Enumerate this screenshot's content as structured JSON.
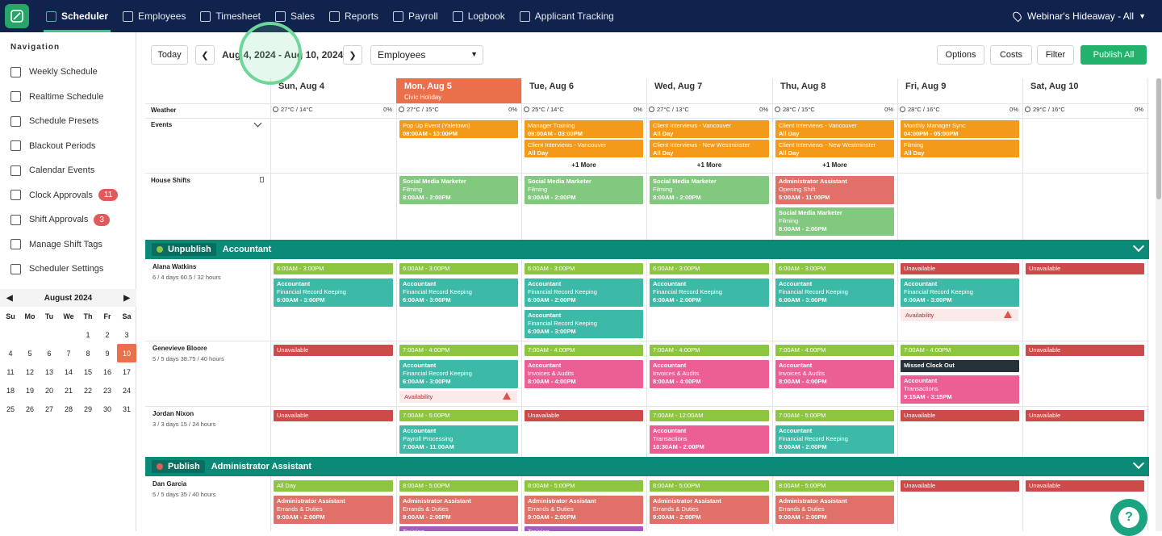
{
  "topbar": {
    "nav": [
      "Scheduler",
      "Employees",
      "Timesheet",
      "Sales",
      "Reports",
      "Payroll",
      "Logbook",
      "Applicant Tracking"
    ],
    "location": "Webinar's Hideaway - All"
  },
  "sidebar": {
    "title": "Navigation",
    "items": [
      {
        "label": "Weekly Schedule",
        "icon": "calendar-icon"
      },
      {
        "label": "Realtime Schedule",
        "icon": "calendar-icon"
      },
      {
        "label": "Schedule Presets",
        "icon": "calendar-edit-icon"
      },
      {
        "label": "Blackout Periods",
        "icon": "calendar-x-icon"
      },
      {
        "label": "Calendar Events",
        "icon": "calendar-star-icon"
      },
      {
        "label": "Clock Approvals",
        "icon": "clock-icon",
        "badge": "11"
      },
      {
        "label": "Shift Approvals",
        "icon": "users-icon",
        "badge": "3"
      },
      {
        "label": "Manage Shift Tags",
        "icon": "tag-icon"
      },
      {
        "label": "Scheduler Settings",
        "icon": "gear-icon"
      }
    ],
    "calendar": {
      "month": "August 2024",
      "dow": [
        "Su",
        "Mo",
        "Tu",
        "We",
        "Th",
        "Fr",
        "Sa"
      ],
      "weeks": [
        [
          "",
          "",
          "",
          "",
          "1",
          "2",
          "3"
        ],
        [
          "4",
          "5",
          "6",
          "7",
          "8",
          "9",
          "10"
        ],
        [
          "11",
          "12",
          "13",
          "14",
          "15",
          "16",
          "17"
        ],
        [
          "18",
          "19",
          "20",
          "21",
          "22",
          "23",
          "24"
        ],
        [
          "25",
          "26",
          "27",
          "28",
          "29",
          "30",
          "31"
        ]
      ],
      "selected": "10"
    }
  },
  "toolbar": {
    "today": "Today",
    "range": "Aug 4, 2024 - Aug 10, 2024",
    "view": "Employees",
    "options": "Options",
    "costs": "Costs",
    "filter": "Filter",
    "publish_all": "Publish All"
  },
  "days": [
    {
      "label": "Sun, Aug 4",
      "sub": "",
      "weather": "27°C / 14°C",
      "rain": "0%"
    },
    {
      "label": "Mon, Aug 5",
      "sub": "Civic Holiday",
      "weather": "27°C / 15°C",
      "rain": "0%",
      "today": true
    },
    {
      "label": "Tue, Aug 6",
      "sub": "",
      "weather": "25°C / 14°C",
      "rain": "0%"
    },
    {
      "label": "Wed, Aug 7",
      "sub": "",
      "weather": "27°C / 13°C",
      "rain": "0%"
    },
    {
      "label": "Thu, Aug 8",
      "sub": "",
      "weather": "28°C / 15°C",
      "rain": "0%"
    },
    {
      "label": "Fri, Aug 9",
      "sub": "",
      "weather": "28°C / 16°C",
      "rain": "0%"
    },
    {
      "label": "Sat, Aug 10",
      "sub": "",
      "weather": "29°C / 16°C",
      "rain": "0%"
    }
  ],
  "rows": {
    "weather": "Weather",
    "events": "Events",
    "house": "House Shifts",
    "more": "+1 More"
  },
  "events": [
    {
      "day": 1,
      "slot": 0,
      "title": "Pop Up Event (Yaletown)",
      "time": "08:00AM - 10:00PM"
    },
    {
      "day": 2,
      "slot": 0,
      "title": "Manager Training",
      "time": "09:00AM - 03:00PM"
    },
    {
      "day": 2,
      "slot": 1,
      "title": "Client Interviews - Vancouver",
      "time": "All Day"
    },
    {
      "day": 3,
      "slot": 0,
      "title": "Client Interviews - Vancouver",
      "time": "All Day"
    },
    {
      "day": 3,
      "slot": 1,
      "title": "Client Interviews - New Westminster",
      "time": "All Day"
    },
    {
      "day": 4,
      "slot": 0,
      "title": "Client Interviews - Vancouver",
      "time": "All Day"
    },
    {
      "day": 4,
      "slot": 1,
      "title": "Client Interviews - New Westminster",
      "time": "All Day"
    },
    {
      "day": 5,
      "slot": 0,
      "title": "Monthly Manager Sync",
      "time": "04:00PM - 05:00PM"
    },
    {
      "day": 5,
      "slot": 1,
      "title": "Filming",
      "time": "All Day"
    }
  ],
  "house_shifts": [
    {
      "day": 1,
      "slot": 0,
      "role": "Social Media Marketer",
      "task": "Filming",
      "time": "8:00AM - 2:00PM",
      "color": "green"
    },
    {
      "day": 2,
      "slot": 0,
      "role": "Social Media Marketer",
      "task": "Filming",
      "time": "8:00AM - 2:00PM",
      "color": "green"
    },
    {
      "day": 3,
      "slot": 0,
      "role": "Social Media Marketer",
      "task": "Filming",
      "time": "8:00AM - 2:00PM",
      "color": "green"
    },
    {
      "day": 4,
      "slot": 0,
      "role": "Administrator Assistant",
      "task": "Opening Shift",
      "time": "5:00AM - 11:00PM",
      "color": "red"
    },
    {
      "day": 4,
      "slot": 1,
      "role": "Social Media Marketer",
      "task": "Filming",
      "time": "8:00AM - 2:00PM",
      "color": "green"
    }
  ],
  "groups": [
    {
      "action": "Unpublish",
      "name": "Accountant",
      "dot": "#8dc53f"
    },
    {
      "action": "Publish",
      "name": "Administrator Assistant",
      "dot": "#e05a5a"
    }
  ],
  "employees": [
    {
      "name": "Alana Watkins",
      "meta": "6 / 4 days   60.5 / 32 hours"
    },
    {
      "name": "Genevieve Bloore",
      "meta": "5 / 5 days   38.75 / 40 hours"
    },
    {
      "name": "Jordan Nixon",
      "meta": "3 / 3 days   15 / 24 hours"
    },
    {
      "name": "Dan Garcia",
      "meta": "5 / 5 days   35 / 40 hours"
    }
  ],
  "labels": {
    "unavailable": "Unavailable",
    "availability": "Availability",
    "missed": "Missed Clock Out",
    "allday": "All Day",
    "training": "Training"
  },
  "shifts": [
    {
      "emp": 0,
      "day": 0,
      "avail": "6:00AM - 3:00PM",
      "blocks": [
        {
          "role": "Accountant",
          "task": "Financial Record Keeping",
          "time": "6:00AM - 3:00PM",
          "color": "teal"
        }
      ]
    },
    {
      "emp": 0,
      "day": 1,
      "avail": "6:00AM - 3:00PM",
      "blocks": [
        {
          "role": "Accountant",
          "task": "Financial Record Keeping",
          "time": "6:00AM - 3:00PM",
          "color": "teal"
        }
      ]
    },
    {
      "emp": 0,
      "day": 2,
      "avail": "6:00AM - 3:00PM",
      "blocks": [
        {
          "role": "Accountant",
          "task": "Financial Record Keeping",
          "time": "6:00AM - 2:00PM",
          "color": "teal"
        },
        {
          "role": "Accountant",
          "task": "Financial Record Keeping",
          "time": "6:00AM - 3:00PM",
          "color": "teal"
        }
      ]
    },
    {
      "emp": 0,
      "day": 3,
      "avail": "6:00AM - 3:00PM",
      "blocks": [
        {
          "role": "Accountant",
          "task": "Financial Record Keeping",
          "time": "6:00AM - 2:00PM",
          "color": "teal"
        }
      ]
    },
    {
      "emp": 0,
      "day": 4,
      "avail": "6:00AM - 3:00PM",
      "blocks": [
        {
          "role": "Accountant",
          "task": "Financial Record Keeping",
          "time": "6:00AM - 3:00PM",
          "color": "teal"
        }
      ]
    },
    {
      "emp": 0,
      "day": 5,
      "unavailable": true,
      "blocks": [
        {
          "role": "Accountant",
          "task": "Financial Record Keeping",
          "time": "6:00AM - 3:00PM",
          "color": "teal"
        }
      ],
      "warning": true
    },
    {
      "emp": 0,
      "day": 6,
      "unavailable": true,
      "blocks": []
    },
    {
      "emp": 1,
      "day": 0,
      "unavailable": true,
      "blocks": []
    },
    {
      "emp": 1,
      "day": 1,
      "avail": "7:00AM - 4:00PM",
      "blocks": [
        {
          "role": "Accountant",
          "task": "Financial Record Keeping",
          "time": "6:00AM - 3:00PM",
          "color": "teal"
        }
      ],
      "warning": true
    },
    {
      "emp": 1,
      "day": 2,
      "avail": "7:00AM - 4:00PM",
      "blocks": [
        {
          "role": "Accountant",
          "task": "Invoices & Audits",
          "time": "8:00AM - 4:00PM",
          "color": "pink"
        }
      ]
    },
    {
      "emp": 1,
      "day": 3,
      "avail": "7:00AM - 4:00PM",
      "blocks": [
        {
          "role": "Accountant",
          "task": "Invoices & Audits",
          "time": "8:00AM - 4:00PM",
          "color": "pink"
        }
      ]
    },
    {
      "emp": 1,
      "day": 4,
      "avail": "7:00AM - 4:00PM",
      "blocks": [
        {
          "role": "Accountant",
          "task": "Invoices & Audits",
          "time": "8:00AM - 4:00PM",
          "color": "pink"
        }
      ]
    },
    {
      "emp": 1,
      "day": 5,
      "avail": "7:00AM - 4:00PM",
      "missed": true,
      "blocks": [
        {
          "role": "Accountant",
          "task": "Transactions",
          "time": "9:15AM - 3:15PM",
          "color": "pink"
        }
      ]
    },
    {
      "emp": 1,
      "day": 6,
      "unavailable": true,
      "blocks": []
    },
    {
      "emp": 2,
      "day": 0,
      "unavailable": true,
      "blocks": []
    },
    {
      "emp": 2,
      "day": 1,
      "avail": "7:00AM - 5:00PM",
      "blocks": [
        {
          "role": "Accountant",
          "task": "Payroll Processing",
          "time": "7:00AM - 11:00AM",
          "color": "teal"
        }
      ]
    },
    {
      "emp": 2,
      "day": 2,
      "unavailable": true,
      "blocks": []
    },
    {
      "emp": 2,
      "day": 3,
      "avail": "7:00AM - 12:00AM",
      "blocks": [
        {
          "role": "Accountant",
          "task": "Transactions",
          "time": "10:30AM - 2:00PM",
          "color": "pink"
        }
      ]
    },
    {
      "emp": 2,
      "day": 4,
      "avail": "7:00AM - 5:00PM",
      "blocks": [
        {
          "role": "Accountant",
          "task": "Financial Record Keeping",
          "time": "8:00AM - 2:00PM",
          "color": "teal"
        }
      ]
    },
    {
      "emp": 2,
      "day": 5,
      "unavailable": true,
      "blocks": []
    },
    {
      "emp": 2,
      "day": 6,
      "unavailable": true,
      "blocks": []
    },
    {
      "emp": 3,
      "day": 0,
      "avail": "All Day",
      "blocks": [
        {
          "role": "Administrator Assistant",
          "task": "Errands & Duties",
          "time": "9:00AM - 2:00PM",
          "color": "red"
        }
      ]
    },
    {
      "emp": 3,
      "day": 1,
      "avail": "8:00AM - 5:00PM",
      "blocks": [
        {
          "role": "Administrator Assistant",
          "task": "Errands & Duties",
          "time": "9:00AM - 2:00PM",
          "color": "red"
        }
      ],
      "training": true
    },
    {
      "emp": 3,
      "day": 2,
      "avail": "8:00AM - 5:00PM",
      "blocks": [
        {
          "role": "Administrator Assistant",
          "task": "Errands & Duties",
          "time": "9:00AM - 2:00PM",
          "color": "red"
        }
      ],
      "training": true
    },
    {
      "emp": 3,
      "day": 3,
      "avail": "8:00AM - 5:00PM",
      "blocks": [
        {
          "role": "Administrator Assistant",
          "task": "Errands & Duties",
          "time": "9:00AM - 2:00PM",
          "color": "red"
        }
      ]
    },
    {
      "emp": 3,
      "day": 4,
      "avail": "8:00AM - 5:00PM",
      "blocks": [
        {
          "role": "Administrator Assistant",
          "task": "Errands & Duties",
          "time": "9:00AM - 2:00PM",
          "color": "red"
        }
      ]
    },
    {
      "emp": 3,
      "day": 5,
      "unavailable": true,
      "blocks": []
    },
    {
      "emp": 3,
      "day": 6,
      "unavailable": true,
      "blocks": []
    }
  ]
}
